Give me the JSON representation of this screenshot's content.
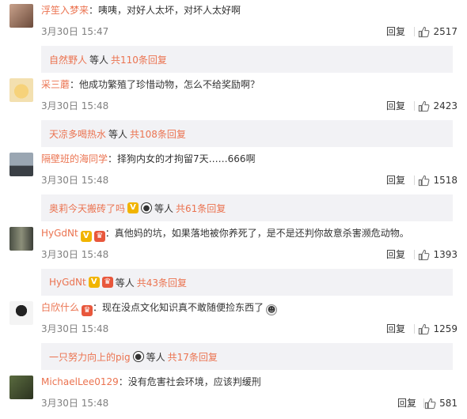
{
  "comments": [
    {
      "user": "浮笙入梦来",
      "text": "咦咦，对好人太坏，对坏人太好啊",
      "date": "3月30日 15:47",
      "reply_label": "回复",
      "likes": "2517",
      "sub": {
        "user": "自然野人",
        "mid": "等人",
        "count": "共110条回复"
      }
    },
    {
      "user": "采三蘑",
      "text": "他成功繁殖了珍惜动物，怎么不给奖励啊？",
      "date": "3月30日 15:48",
      "reply_label": "回复",
      "likes": "2423",
      "sub": {
        "user": "天凉多喝热水",
        "mid": "等人",
        "count": "共108条回复"
      }
    },
    {
      "user": "隔壁班的海同学",
      "text": "择狗内女的才拘留7天……666啊",
      "date": "3月30日 15:48",
      "reply_label": "回复",
      "likes": "1518",
      "sub": {
        "user": "奥莉今天搬砖了吗",
        "mid": "等人",
        "count": "共61条回复"
      }
    },
    {
      "user": "HyGdNt",
      "text": "真他妈的坑，如果落地被你养死了，是不是还判你故意杀害濒危动物。",
      "date": "3月30日 15:48",
      "reply_label": "回复",
      "likes": "1393",
      "sub": {
        "user": "HyGdNt",
        "mid": "等人",
        "count": "共43条回复"
      }
    },
    {
      "user": "白欣什么",
      "text": "现在没点文化知识真不敢随便捡东西了",
      "date": "3月30日 15:48",
      "reply_label": "回复",
      "likes": "1259",
      "sub": {
        "user": "一只努力向上的pig",
        "mid": "等人",
        "count": "共17条回复"
      }
    },
    {
      "user": "MichaelLee0129",
      "text": "没有危害社会环境，应该判缓刑",
      "date": "3月30日 15:48",
      "reply_label": "回复",
      "likes": "581"
    }
  ],
  "colors": {
    "link": "#eb7350",
    "subbar_bg": "#f2f2f5",
    "date": "#808080"
  }
}
